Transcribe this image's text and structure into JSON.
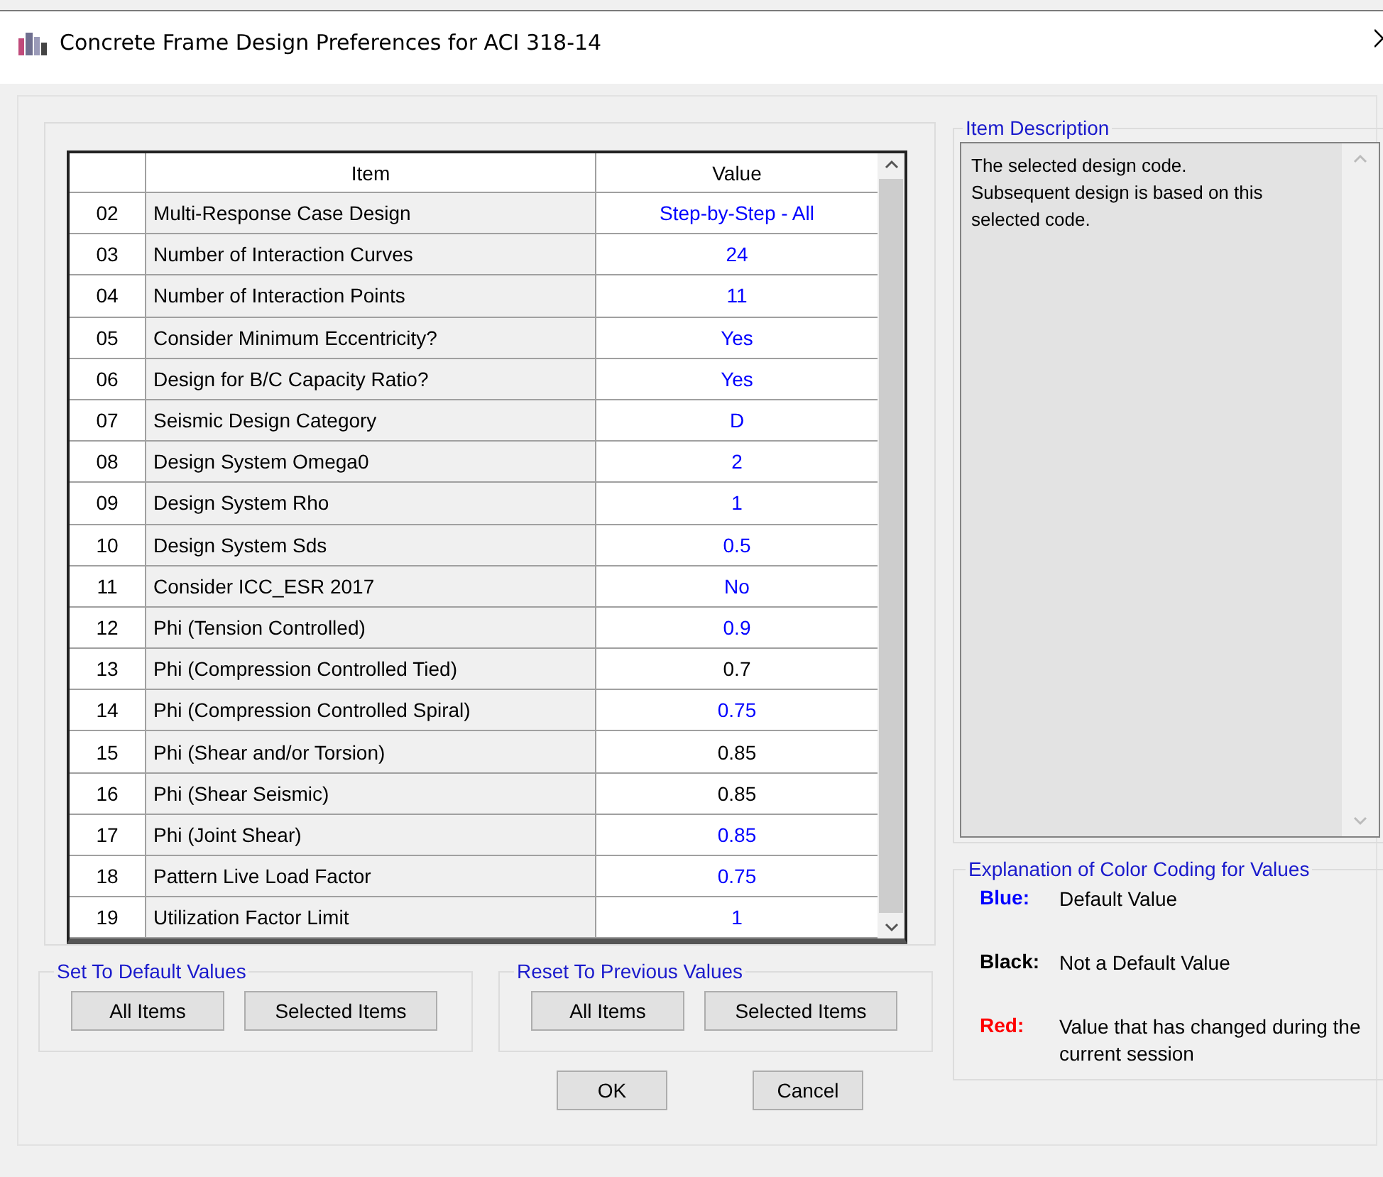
{
  "window": {
    "title": "Concrete Frame Design Preferences for ACI 318-14"
  },
  "table": {
    "columns": [
      "Item",
      "Value"
    ],
    "rows": [
      {
        "number": "02",
        "item": "Multi-Response Case Design",
        "value": "Step-by-Step - All",
        "color": "#0000ff"
      },
      {
        "number": "03",
        "item": "Number of Interaction Curves",
        "value": "24",
        "color": "#0000ff"
      },
      {
        "number": "04",
        "item": "Number of Interaction Points",
        "value": "11",
        "color": "#0000ff"
      },
      {
        "number": "05",
        "item": "Consider Minimum Eccentricity?",
        "value": "Yes",
        "color": "#0000ff"
      },
      {
        "number": "06",
        "item": "Design for B/C Capacity Ratio?",
        "value": "Yes",
        "color": "#0000ff"
      },
      {
        "number": "07",
        "item": "Seismic Design Category",
        "value": "D",
        "color": "#0000ff"
      },
      {
        "number": "08",
        "item": "Design System Omega0",
        "value": "2",
        "color": "#0000ff"
      },
      {
        "number": "09",
        "item": "Design System Rho",
        "value": "1",
        "color": "#0000ff"
      },
      {
        "number": "10",
        "item": "Design System Sds",
        "value": "0.5",
        "color": "#0000ff"
      },
      {
        "number": "11",
        "item": "Consider ICC_ESR 2017",
        "value": "No",
        "color": "#0000ff"
      },
      {
        "number": "12",
        "item": "Phi (Tension Controlled)",
        "value": "0.9",
        "color": "#0000ff"
      },
      {
        "number": "13",
        "item": "Phi (Compression Controlled Tied)",
        "value": "0.7",
        "color": "#000000"
      },
      {
        "number": "14",
        "item": "Phi (Compression Controlled Spiral)",
        "value": "0.75",
        "color": "#0000ff"
      },
      {
        "number": "15",
        "item": "Phi (Shear and/or Torsion)",
        "value": "0.85",
        "color": "#000000"
      },
      {
        "number": "16",
        "item": "Phi (Shear Seismic)",
        "value": "0.85",
        "color": "#000000"
      },
      {
        "number": "17",
        "item": "Phi (Joint Shear)",
        "value": "0.85",
        "color": "#0000ff"
      },
      {
        "number": "18",
        "item": "Pattern Live Load Factor",
        "value": "0.75",
        "color": "#0000ff"
      },
      {
        "number": "19",
        "item": "Utilization Factor Limit",
        "value": "1",
        "color": "#0000ff"
      }
    ]
  },
  "set_to_default": {
    "title": "Set To Default Values",
    "buttons": [
      "All Items",
      "Selected Items"
    ]
  },
  "reset_to_previous": {
    "title": "Reset To Previous Values",
    "buttons": [
      "All Items",
      "Selected Items"
    ]
  },
  "item_description": {
    "title": "Item Description",
    "text": "The selected design code.\nSubsequent design is based on this selected code."
  },
  "color_coding": {
    "title": "Explanation of Color Coding for Values",
    "entries": [
      {
        "label": "Blue:",
        "color": "#0000ff",
        "text": "Default Value"
      },
      {
        "label": "Black:",
        "color": "#000000",
        "text": "Not a Default Value"
      },
      {
        "label": "Red:",
        "color": "#ff0000",
        "text": "Value that has changed during the current session"
      }
    ]
  },
  "buttons": [
    "OK",
    "Cancel"
  ]
}
